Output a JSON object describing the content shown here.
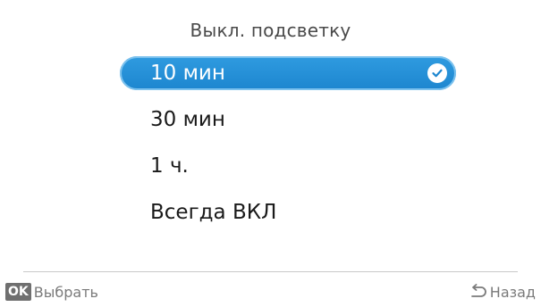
{
  "menu": {
    "title": "Выкл. подсветку",
    "options": [
      {
        "label": "10 мин",
        "selected": true
      },
      {
        "label": "30 мин",
        "selected": false
      },
      {
        "label": "1 ч.",
        "selected": false
      },
      {
        "label": "Всегда ВКЛ",
        "selected": false
      }
    ]
  },
  "footer": {
    "ok_key": "OK",
    "select_label": "Выбрать",
    "back_label": "Назад"
  },
  "colors": {
    "accent": "#1d86cf",
    "text": "#1a1a1a",
    "muted": "#7a7a7a"
  },
  "icons": {
    "selected_marker": "check-icon",
    "back": "back-arrow-icon"
  }
}
